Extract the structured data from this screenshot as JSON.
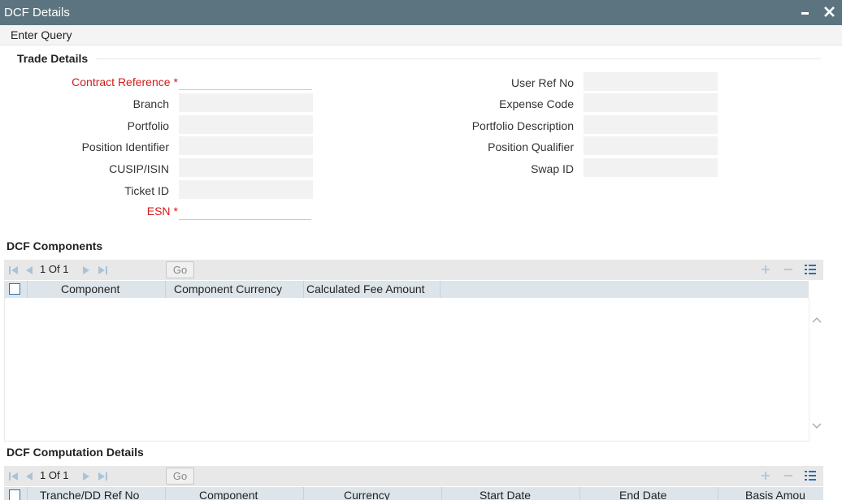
{
  "window": {
    "title": "DCF Details"
  },
  "menu": {
    "enter_query": "Enter Query"
  },
  "trade_details": {
    "heading": "Trade Details",
    "left_fields": [
      {
        "label": "Contract Reference",
        "value": ""
      },
      {
        "label": "Branch",
        "value": ""
      },
      {
        "label": "Portfolio",
        "value": ""
      },
      {
        "label": "Position Identifier",
        "value": ""
      },
      {
        "label": "CUSIP/ISIN",
        "value": ""
      },
      {
        "label": "Ticket ID",
        "value": ""
      },
      {
        "label": "ESN",
        "value": ""
      }
    ],
    "right_fields": [
      {
        "label": "User Ref No",
        "value": ""
      },
      {
        "label": "Expense Code",
        "value": ""
      },
      {
        "label": "Portfolio Description",
        "value": ""
      },
      {
        "label": "Position Qualifier",
        "value": ""
      },
      {
        "label": "Swap ID",
        "value": ""
      }
    ],
    "required_marker": "*"
  },
  "dcf_components": {
    "heading": "DCF Components",
    "pagination": {
      "current": "1",
      "of_label": "Of",
      "total": "1",
      "go_label": "Go"
    },
    "columns": [
      "Component",
      "Component Currency",
      "Calculated Fee Amount"
    ],
    "rows": []
  },
  "dcf_computation": {
    "heading": "DCF Computation Details",
    "pagination": {
      "current": "1",
      "of_label": "Of",
      "total": "1",
      "go_label": "Go"
    },
    "columns": [
      "Tranche/DD Ref No",
      "Component",
      "Currency",
      "Start Date",
      "End Date",
      "Basis Amou"
    ]
  },
  "colors": {
    "titlebar": "#5c7480",
    "required": "#d11b1b",
    "grid_header": "#dde5ea",
    "toolbar_icon": "#2a6fb0"
  },
  "icons": {
    "minimize": "minimize-icon",
    "close": "close-icon",
    "first": "first-page-icon",
    "prev": "prev-page-icon",
    "next": "next-page-icon",
    "last": "last-page-icon",
    "add": "add-row-icon",
    "delete": "delete-row-icon",
    "view": "single-view-icon"
  }
}
